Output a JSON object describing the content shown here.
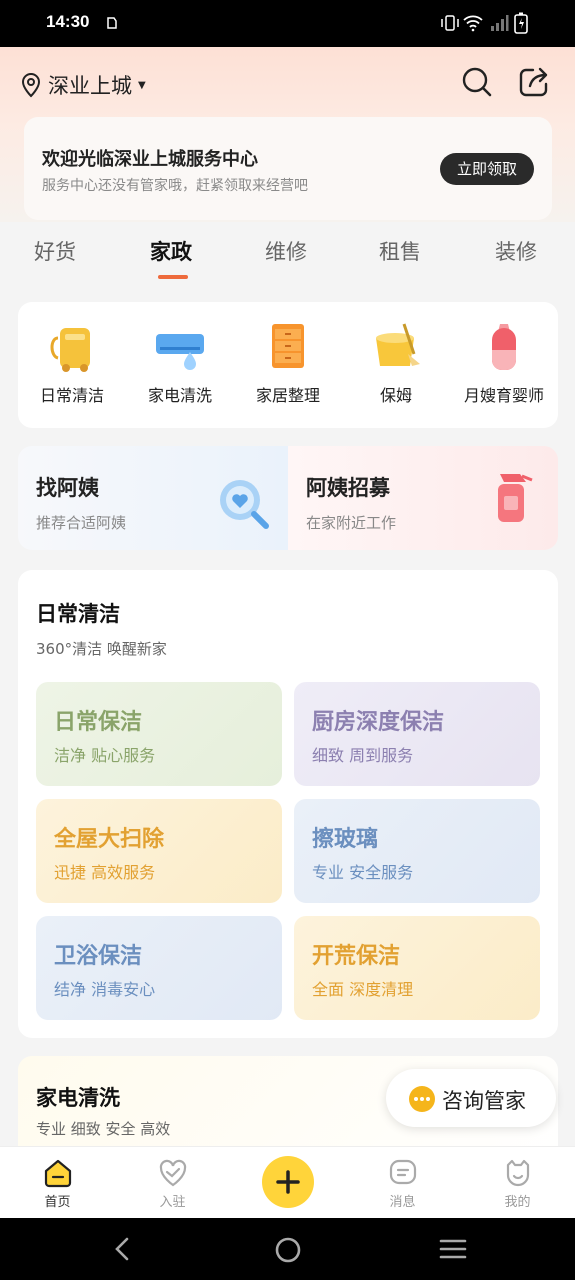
{
  "status_bar": {
    "time": "14:30"
  },
  "header": {
    "location": "深业上城"
  },
  "banner": {
    "title": "欢迎光临深业上城服务中心",
    "subtitle": "服务中心还没有管家哦，赶紧领取来经营吧",
    "button": "立即领取"
  },
  "tabs": [
    "好货",
    "家政",
    "维修",
    "租售",
    "装修"
  ],
  "active_tab": "家政",
  "categories": [
    {
      "label": "日常清洁",
      "icon": "vacuum-cleaner-icon"
    },
    {
      "label": "家电清洗",
      "icon": "air-conditioner-icon"
    },
    {
      "label": "家居整理",
      "icon": "drawer-cabinet-icon"
    },
    {
      "label": "保姆",
      "icon": "bucket-mop-icon"
    },
    {
      "label": "月嫂育婴师",
      "icon": "baby-bottle-icon"
    }
  ],
  "promos": [
    {
      "title": "找阿姨",
      "subtitle": "推荐合适阿姨",
      "icon": "magnifier-heart-icon"
    },
    {
      "title": "阿姨招募",
      "subtitle": "在家附近工作",
      "icon": "spray-bottle-icon"
    }
  ],
  "daily_cleaning": {
    "title": "日常清洁",
    "subtitle": "360°清洁 唤醒新家",
    "tiles": [
      {
        "title": "日常保洁",
        "subtitle": "洁净 贴心服务",
        "color": "#8aa46a"
      },
      {
        "title": "厨房深度保洁",
        "subtitle": "细致 周到服务",
        "color": "#8c80b0"
      },
      {
        "title": "全屋大扫除",
        "subtitle": "迅捷 高效服务",
        "color": "#e2a132"
      },
      {
        "title": "擦玻璃",
        "subtitle": "专业 安全服务",
        "color": "#6b8fbf"
      },
      {
        "title": "卫浴保洁",
        "subtitle": "结净 消毒安心",
        "color": "#6b8fbf"
      },
      {
        "title": "开荒保洁",
        "subtitle": "全面 深度清理",
        "color": "#e2a132"
      }
    ]
  },
  "appliance_cleaning": {
    "title": "家电清洗",
    "subtitle": "专业 细致 安全 高效"
  },
  "consult_button": "咨询管家",
  "bottom_nav": [
    {
      "label": "首页",
      "icon": "home-icon"
    },
    {
      "label": "入驻",
      "icon": "handshake-icon"
    },
    {
      "label": "",
      "icon": "plus-icon"
    },
    {
      "label": "消息",
      "icon": "message-icon"
    },
    {
      "label": "我的",
      "icon": "profile-icon"
    }
  ],
  "colors": {
    "accent": "#ee6a3c",
    "plus_button": "#ffd43a"
  }
}
